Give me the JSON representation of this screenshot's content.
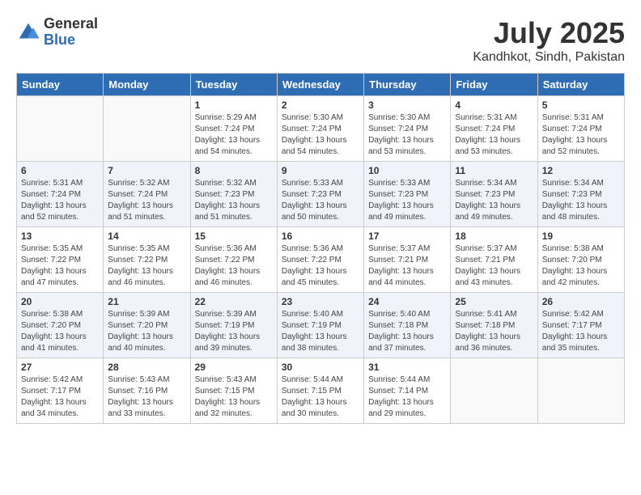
{
  "logo": {
    "general": "General",
    "blue": "Blue"
  },
  "title": {
    "month": "July 2025",
    "location": "Kandhkot, Sindh, Pakistan"
  },
  "headers": [
    "Sunday",
    "Monday",
    "Tuesday",
    "Wednesday",
    "Thursday",
    "Friday",
    "Saturday"
  ],
  "weeks": [
    {
      "shaded": false,
      "days": [
        {
          "empty": true
        },
        {
          "empty": true
        },
        {
          "num": "1",
          "info": "Sunrise: 5:29 AM\nSunset: 7:24 PM\nDaylight: 13 hours and 54 minutes."
        },
        {
          "num": "2",
          "info": "Sunrise: 5:30 AM\nSunset: 7:24 PM\nDaylight: 13 hours and 54 minutes."
        },
        {
          "num": "3",
          "info": "Sunrise: 5:30 AM\nSunset: 7:24 PM\nDaylight: 13 hours and 53 minutes."
        },
        {
          "num": "4",
          "info": "Sunrise: 5:31 AM\nSunset: 7:24 PM\nDaylight: 13 hours and 53 minutes."
        },
        {
          "num": "5",
          "info": "Sunrise: 5:31 AM\nSunset: 7:24 PM\nDaylight: 13 hours and 52 minutes."
        }
      ]
    },
    {
      "shaded": true,
      "days": [
        {
          "num": "6",
          "info": "Sunrise: 5:31 AM\nSunset: 7:24 PM\nDaylight: 13 hours and 52 minutes."
        },
        {
          "num": "7",
          "info": "Sunrise: 5:32 AM\nSunset: 7:24 PM\nDaylight: 13 hours and 51 minutes."
        },
        {
          "num": "8",
          "info": "Sunrise: 5:32 AM\nSunset: 7:23 PM\nDaylight: 13 hours and 51 minutes."
        },
        {
          "num": "9",
          "info": "Sunrise: 5:33 AM\nSunset: 7:23 PM\nDaylight: 13 hours and 50 minutes."
        },
        {
          "num": "10",
          "info": "Sunrise: 5:33 AM\nSunset: 7:23 PM\nDaylight: 13 hours and 49 minutes."
        },
        {
          "num": "11",
          "info": "Sunrise: 5:34 AM\nSunset: 7:23 PM\nDaylight: 13 hours and 49 minutes."
        },
        {
          "num": "12",
          "info": "Sunrise: 5:34 AM\nSunset: 7:23 PM\nDaylight: 13 hours and 48 minutes."
        }
      ]
    },
    {
      "shaded": false,
      "days": [
        {
          "num": "13",
          "info": "Sunrise: 5:35 AM\nSunset: 7:22 PM\nDaylight: 13 hours and 47 minutes."
        },
        {
          "num": "14",
          "info": "Sunrise: 5:35 AM\nSunset: 7:22 PM\nDaylight: 13 hours and 46 minutes."
        },
        {
          "num": "15",
          "info": "Sunrise: 5:36 AM\nSunset: 7:22 PM\nDaylight: 13 hours and 46 minutes."
        },
        {
          "num": "16",
          "info": "Sunrise: 5:36 AM\nSunset: 7:22 PM\nDaylight: 13 hours and 45 minutes."
        },
        {
          "num": "17",
          "info": "Sunrise: 5:37 AM\nSunset: 7:21 PM\nDaylight: 13 hours and 44 minutes."
        },
        {
          "num": "18",
          "info": "Sunrise: 5:37 AM\nSunset: 7:21 PM\nDaylight: 13 hours and 43 minutes."
        },
        {
          "num": "19",
          "info": "Sunrise: 5:38 AM\nSunset: 7:20 PM\nDaylight: 13 hours and 42 minutes."
        }
      ]
    },
    {
      "shaded": true,
      "days": [
        {
          "num": "20",
          "info": "Sunrise: 5:38 AM\nSunset: 7:20 PM\nDaylight: 13 hours and 41 minutes."
        },
        {
          "num": "21",
          "info": "Sunrise: 5:39 AM\nSunset: 7:20 PM\nDaylight: 13 hours and 40 minutes."
        },
        {
          "num": "22",
          "info": "Sunrise: 5:39 AM\nSunset: 7:19 PM\nDaylight: 13 hours and 39 minutes."
        },
        {
          "num": "23",
          "info": "Sunrise: 5:40 AM\nSunset: 7:19 PM\nDaylight: 13 hours and 38 minutes."
        },
        {
          "num": "24",
          "info": "Sunrise: 5:40 AM\nSunset: 7:18 PM\nDaylight: 13 hours and 37 minutes."
        },
        {
          "num": "25",
          "info": "Sunrise: 5:41 AM\nSunset: 7:18 PM\nDaylight: 13 hours and 36 minutes."
        },
        {
          "num": "26",
          "info": "Sunrise: 5:42 AM\nSunset: 7:17 PM\nDaylight: 13 hours and 35 minutes."
        }
      ]
    },
    {
      "shaded": false,
      "days": [
        {
          "num": "27",
          "info": "Sunrise: 5:42 AM\nSunset: 7:17 PM\nDaylight: 13 hours and 34 minutes."
        },
        {
          "num": "28",
          "info": "Sunrise: 5:43 AM\nSunset: 7:16 PM\nDaylight: 13 hours and 33 minutes."
        },
        {
          "num": "29",
          "info": "Sunrise: 5:43 AM\nSunset: 7:15 PM\nDaylight: 13 hours and 32 minutes."
        },
        {
          "num": "30",
          "info": "Sunrise: 5:44 AM\nSunset: 7:15 PM\nDaylight: 13 hours and 30 minutes."
        },
        {
          "num": "31",
          "info": "Sunrise: 5:44 AM\nSunset: 7:14 PM\nDaylight: 13 hours and 29 minutes."
        },
        {
          "empty": true
        },
        {
          "empty": true
        }
      ]
    }
  ]
}
